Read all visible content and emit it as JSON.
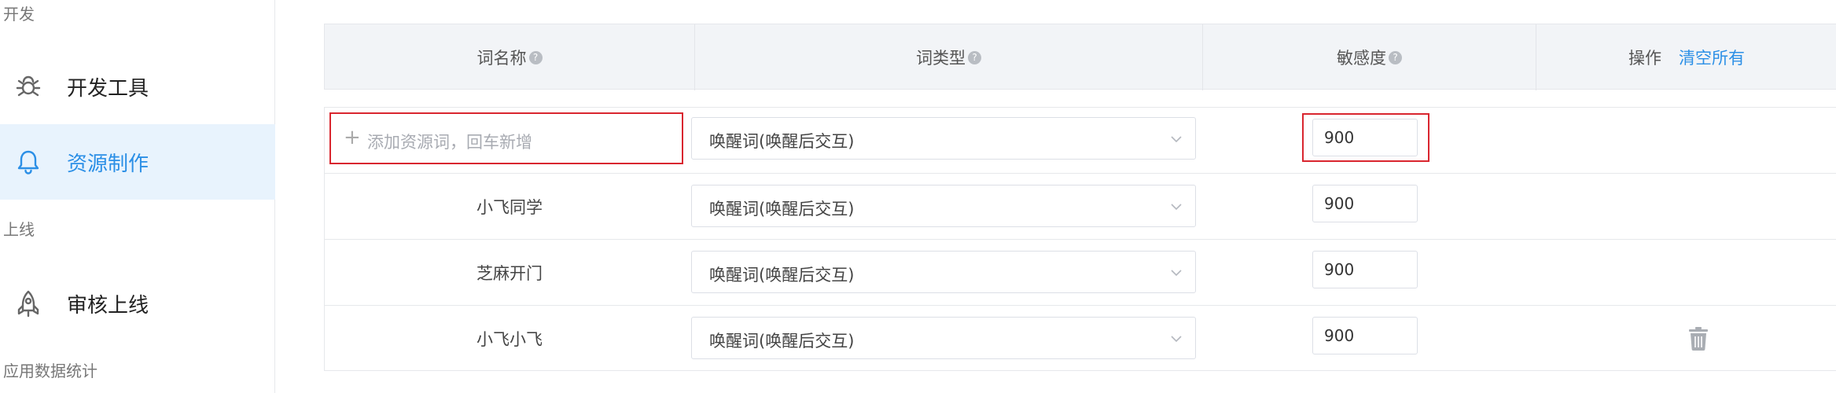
{
  "sidebar": {
    "sections": [
      {
        "label": "开发"
      },
      {
        "label": "上线"
      },
      {
        "label": "应用数据统计"
      }
    ],
    "items": [
      {
        "label": "开发工具",
        "icon": "bug-icon",
        "active": false
      },
      {
        "label": "资源制作",
        "icon": "bell-icon",
        "active": true
      },
      {
        "label": "审核上线",
        "icon": "rocket-icon",
        "active": false
      }
    ]
  },
  "table": {
    "headers": {
      "word_name": "词名称",
      "word_type": "词类型",
      "sensitivity": "敏感度",
      "actions": "操作",
      "clear_all": "清空所有"
    },
    "new_row": {
      "placeholder": "添加资源词，回车新增",
      "type": "唤醒词(唤醒后交互)",
      "sensitivity": "900"
    },
    "rows": [
      {
        "name": "小飞同学",
        "type": "唤醒词(唤醒后交互)",
        "sensitivity": "900"
      },
      {
        "name": "芝麻开门",
        "type": "唤醒词(唤醒后交互)",
        "sensitivity": "900"
      },
      {
        "name": "小飞小飞",
        "type": "唤醒词(唤醒后交互)",
        "sensitivity": "900",
        "has_delete": true
      }
    ]
  },
  "colors": {
    "accent": "#2b8fe6",
    "active_bg": "#e8f3fd",
    "highlight": "#d9262f",
    "header_bg": "#f2f4f7"
  }
}
